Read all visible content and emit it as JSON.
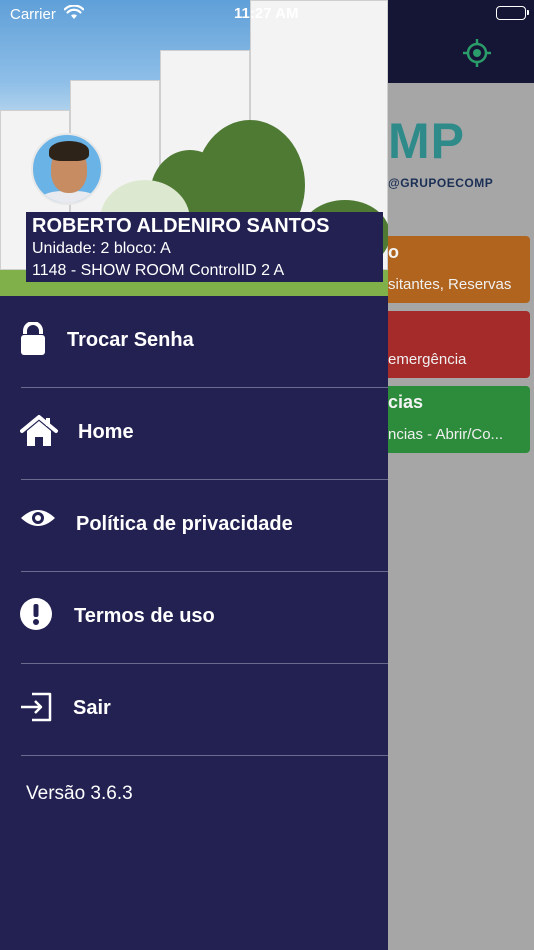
{
  "status_bar": {
    "carrier": "Carrier",
    "time": "11:27 AM"
  },
  "background_screen": {
    "brand_text": "MP",
    "email_text": "@GRUPOECOMP",
    "cards": [
      {
        "title": "o",
        "subtitle": "sitantes, Reservas",
        "color": "#b0641e"
      },
      {
        "title": "",
        "subtitle": "emergência",
        "color": "#a52a2a"
      },
      {
        "title": "cias",
        "subtitle": "ncias - Abrir/Co...",
        "color": "#2c8c3c"
      }
    ],
    "target_icon": "location-target-icon",
    "accent_color": "#2f8a8a"
  },
  "drawer": {
    "user": {
      "name": "ROBERTO ALDENIRO SANTOS",
      "unit": "Unidade: 2 bloco: A",
      "site": "1148 - SHOW ROOM ControlID 2 A"
    },
    "menu": [
      {
        "label": "Trocar Senha",
        "icon": "lock-icon"
      },
      {
        "label": "Home",
        "icon": "home-icon"
      },
      {
        "label": "Política de privacidade",
        "icon": "eye-icon"
      },
      {
        "label": "Termos de uso",
        "icon": "exclamation-circle-icon"
      },
      {
        "label": "Sair",
        "icon": "sign-out-icon"
      }
    ],
    "version": "Versão 3.6.3",
    "background_color": "#222152"
  }
}
